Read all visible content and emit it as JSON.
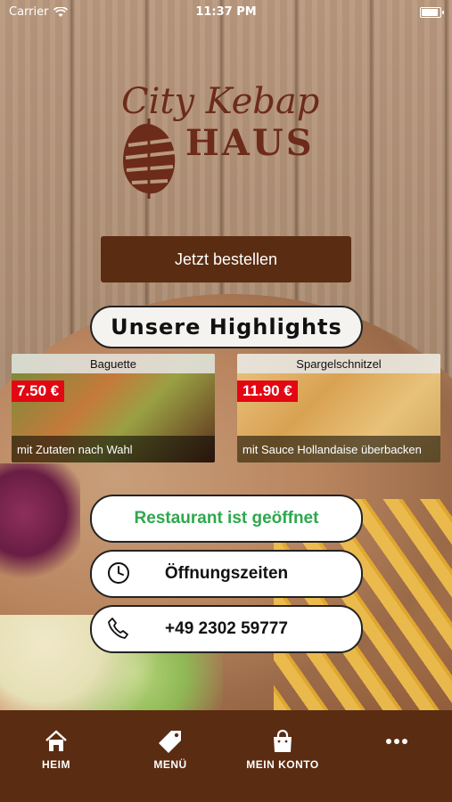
{
  "status_bar": {
    "carrier": "Carrier",
    "time": "11:37 PM"
  },
  "logo": {
    "line1": "City Kebap",
    "line2": "HAUS"
  },
  "order_button": {
    "label": "Jetzt bestellen"
  },
  "highlights": {
    "title": "Unsere Highlights",
    "items": [
      {
        "name": "Baguette",
        "price": "7.50 €",
        "caption": "mit Zutaten nach Wahl"
      },
      {
        "name": "Spargelschnitzel",
        "price": "11.90 €",
        "caption": "mit Sauce Hollandaise überbacken"
      }
    ]
  },
  "status": {
    "label": "Restaurant ist geöffnet",
    "color": "#2ea84c"
  },
  "hours_button": {
    "label": "Öffnungszeiten",
    "icon": "clock-icon"
  },
  "phone_button": {
    "label": "+49 2302 59777",
    "icon": "phone-icon"
  },
  "tabbar": {
    "tabs": [
      {
        "label": "HEIM",
        "icon": "home-icon"
      },
      {
        "label": "MENÜ",
        "icon": "tag-icon"
      },
      {
        "label": "MEIN KONTO",
        "icon": "bag-icon"
      },
      {
        "label": "",
        "icon": "more-icon"
      }
    ]
  },
  "colors": {
    "brand_brown": "#5a2c12",
    "price_red": "#e30613"
  }
}
